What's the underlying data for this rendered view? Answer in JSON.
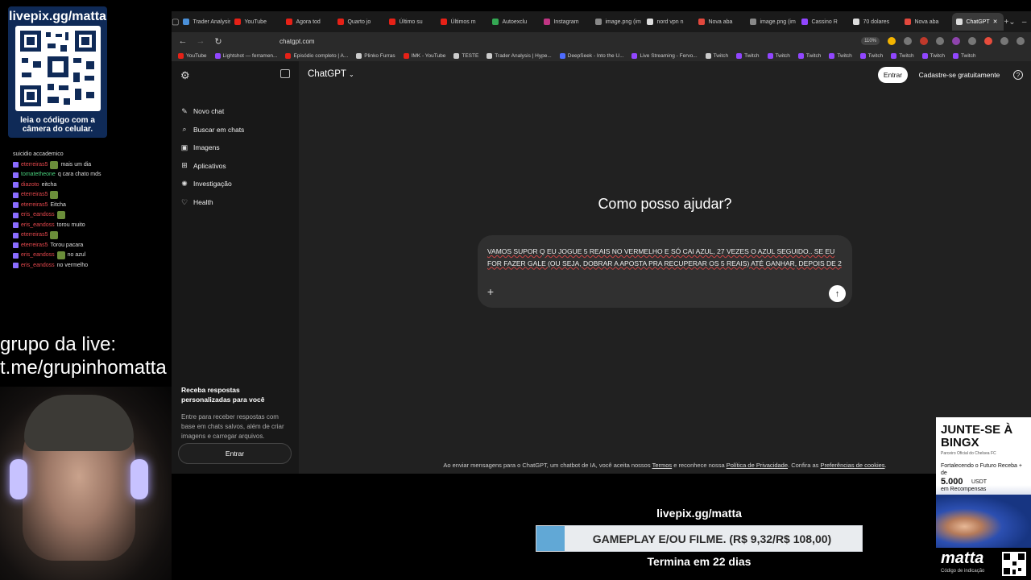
{
  "overlay": {
    "qr_title": "livepix.gg/matta",
    "qr_caption": "leia o código com a câmera do celular.",
    "chat": [
      {
        "user": "suicidio accademico",
        "msg": "",
        "kind": "plain"
      },
      {
        "user": "eterreiras5",
        "msg": "mais um dia",
        "kind": "red"
      },
      {
        "user": "tomatetheone",
        "msg": "q cara chato mds",
        "kind": "green"
      },
      {
        "user": "diazoto",
        "msg": "eitcha",
        "kind": "red"
      },
      {
        "user": "eterreiras5",
        "msg": "",
        "kind": "red"
      },
      {
        "user": "eterreiras5",
        "msg": "Eitcha",
        "kind": "red"
      },
      {
        "user": "eris_eandoss",
        "msg": "",
        "kind": "red"
      },
      {
        "user": "eris_eandoss",
        "msg": "torou muito",
        "kind": "red"
      },
      {
        "user": "eterreiras5",
        "msg": "",
        "kind": "red"
      },
      {
        "user": "eterreiras5",
        "msg": "Torou pacara",
        "kind": "red"
      },
      {
        "user": "eris_eandoss",
        "msg": "no azul",
        "kind": "red"
      },
      {
        "user": "eris_eandoss",
        "msg": "no vermelho",
        "kind": "red"
      }
    ],
    "group_label": "grupo da live:",
    "group_link": "t.me/grupinhomatta",
    "livepix_bottom": "livepix.gg/matta",
    "goal_text": "GAMEPLAY E/OU FILME. (R$ 9,32/R$ 108,00)",
    "goal_progress": 0.086,
    "goal_ends": "Termina em 22 dias",
    "ad": {
      "title": "JUNTE-SE À BINGX",
      "sub": "Parceiro Oficial do Chelsea FC",
      "desc": "Fortalecendo o Futuro Receba + de",
      "amount": "5.000",
      "amount_unit": "USDT",
      "rewards": "em Recompensas"
    },
    "brand_name": "matta",
    "brand_code": "Código de indicação"
  },
  "browser": {
    "tabs": [
      {
        "label": "Trader Analysis",
        "color": "#4a90d9"
      },
      {
        "label": "YouTube",
        "color": "#e62117"
      },
      {
        "label": "Agora tod",
        "color": "#e62117"
      },
      {
        "label": "Quarto jo",
        "color": "#e62117"
      },
      {
        "label": "Último su",
        "color": "#e62117"
      },
      {
        "label": "Últimos m",
        "color": "#e62117"
      },
      {
        "label": "Autoexclu",
        "color": "#34a853"
      },
      {
        "label": "Instagram",
        "color": "#c13584"
      },
      {
        "label": "image.png (im",
        "color": "#888888"
      },
      {
        "label": "nord vpn n",
        "color": "#dddddd"
      },
      {
        "label": "Nova aba",
        "color": "#e2483d"
      },
      {
        "label": "image.png (im",
        "color": "#888888"
      },
      {
        "label": "Cassino R",
        "color": "#9146ff"
      },
      {
        "label": "70 dolares",
        "color": "#dddddd"
      },
      {
        "label": "Nova aba",
        "color": "#e2483d"
      },
      {
        "label": "ChatGPT",
        "color": "#dddddd"
      }
    ],
    "url": "chatgpt.com",
    "zoom": "110%",
    "bookmarks": [
      {
        "label": "YouTube",
        "color": "#e62117"
      },
      {
        "label": "Lightshot — ferramen...",
        "color": "#9146ff"
      },
      {
        "label": "Episódio completo | A...",
        "color": "#e62117"
      },
      {
        "label": "Plinko Furras",
        "color": "#cccccc"
      },
      {
        "label": "IMK - YouTube",
        "color": "#e62117"
      },
      {
        "label": "TESTE",
        "color": "#cccccc"
      },
      {
        "label": "Trader Analysis | Hype...",
        "color": "#cccccc"
      },
      {
        "label": "DeepSeek - Into the U...",
        "color": "#4d6bfe"
      },
      {
        "label": "Live Streaming - Fervo...",
        "color": "#9146ff"
      },
      {
        "label": "Twitch",
        "color": "#cccccc"
      },
      {
        "label": "Twitch",
        "color": "#9146ff"
      },
      {
        "label": "Twitch",
        "color": "#9146ff"
      },
      {
        "label": "Twitch",
        "color": "#9146ff"
      },
      {
        "label": "Twitch",
        "color": "#9146ff"
      },
      {
        "label": "Twitch",
        "color": "#9146ff"
      },
      {
        "label": "Twitch",
        "color": "#9146ff"
      },
      {
        "label": "Twitch",
        "color": "#9146ff"
      },
      {
        "label": "Twitch",
        "color": "#9146ff"
      }
    ]
  },
  "chatgpt": {
    "sidebar": {
      "items": [
        {
          "label": "Novo chat",
          "icon": "✎"
        },
        {
          "label": "Buscar em chats",
          "icon": "⌕"
        },
        {
          "label": "Imagens",
          "icon": "▣"
        },
        {
          "label": "Aplicativos",
          "icon": "⊞"
        },
        {
          "label": "Investigação",
          "icon": "✺"
        },
        {
          "label": "Health",
          "icon": "♡"
        }
      ],
      "promo_title": "Receba respostas personalizadas para você",
      "promo_text": "Entre para receber respostas com base em chats salvos, além de criar imagens e carregar arquivos.",
      "login": "Entrar"
    },
    "model": "ChatGPT",
    "login": "Entrar",
    "signup": "Cadastre-se gratuitamente",
    "heading": "Como posso ajudar?",
    "prompt": "VAMOS SUPOR Q EU JOGUE 5 REAIS NO VERMELHO E SÓ CAI AZUL, 27 VEZES O AZUL SEGUIDO.. SE EU FOR FAZER GALE (OU SEJA, DOBRAR A APOSTA PRA RECUPERAR OS 5 REAIS) ATÉ GANHAR, DEPOIS DE 2",
    "footer": {
      "prefix": "Ao enviar mensagens para o ChatGPT, um chatbot de IA, você aceita nossos",
      "terms": "Termos",
      "middle": "e reconhece nossa",
      "privacy": "Política de Privacidade",
      "confirm": ". Confira as",
      "cookies": "Preferências de cookies",
      "end": "."
    }
  }
}
